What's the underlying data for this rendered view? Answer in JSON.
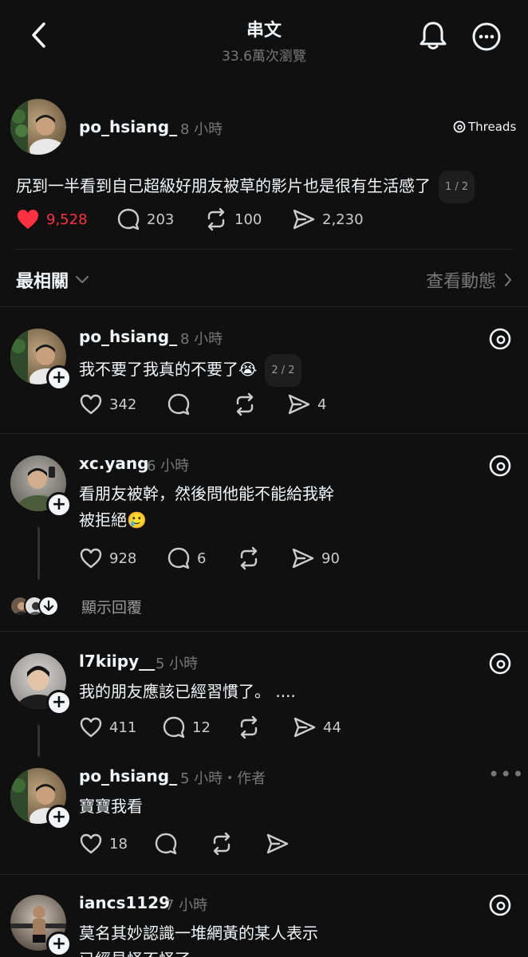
{
  "header": {
    "title": "串文",
    "views": "33.6萬次瀏覽"
  },
  "main_post": {
    "username": "po_hsiang_",
    "time": "8 小時",
    "badge": "Threads",
    "text": "尻到一半看到自己超級好朋友被草的影片也是很有生活感了",
    "pager": "1 / 2",
    "likes": "9,528",
    "comments": "203",
    "reposts": "100",
    "shares": "2,230",
    "like_color": "#ff3040"
  },
  "sort": {
    "label": "最相關",
    "activity": "查看動態"
  },
  "replies": [
    {
      "username": "po_hsiang_",
      "time": "8 小時",
      "line1": "我不要了我真的不要了😭",
      "pager": "2 / 2",
      "likes": "342",
      "comments": "",
      "reposts": "",
      "shares": "4"
    },
    {
      "username": "xc.yang",
      "time": "6 小時",
      "line1": "看朋友被幹，然後問他能不能給我幹",
      "line2": "被拒絕🥲",
      "likes": "928",
      "comments": "6",
      "reposts": "",
      "shares": "90"
    },
    {
      "username": "l7kiipy__",
      "time": "5 小時",
      "line1": "我的朋友應該已經習慣了。 ....",
      "likes": "411",
      "comments": "12",
      "reposts": "",
      "shares": "44"
    },
    {
      "username": "po_hsiang_",
      "time": "5 小時・作者",
      "line1": "寶寶我看",
      "likes": "18",
      "comments": "",
      "reposts": "",
      "shares": ""
    },
    {
      "username": "iancs1129",
      "time": "7 小時",
      "line1": "莫名其妙認識一堆網黃的某人表示",
      "line2": "已經見怪不怪了"
    }
  ],
  "show_replies": "顯示回覆"
}
